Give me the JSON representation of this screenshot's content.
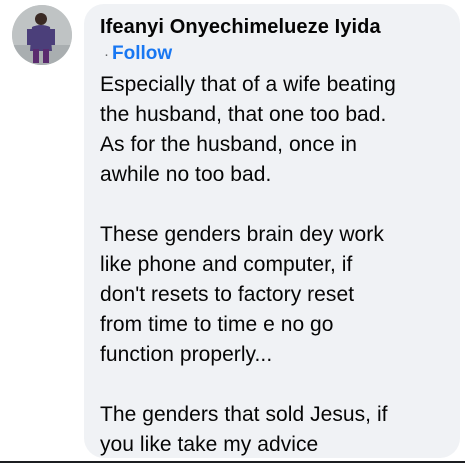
{
  "comment": {
    "author_name": "Ifeanyi Onyechimelueze Iyida",
    "separator": "·",
    "follow_label": "Follow",
    "paragraphs": [
      [
        "Especially that of a wife beating",
        "the husband, that one too bad.",
        "As for the husband, once in",
        "awhile no too bad."
      ],
      [
        "These genders brain dey work",
        "like phone and computer, if",
        "don't resets to factory reset",
        "from time to time e no go",
        "function properly..."
      ],
      [
        "The genders that sold Jesus, if",
        "you like take my advice"
      ]
    ]
  },
  "colors": {
    "bubble_background": "#f0f2f5",
    "link": "#1877f2",
    "text": "#050505"
  }
}
